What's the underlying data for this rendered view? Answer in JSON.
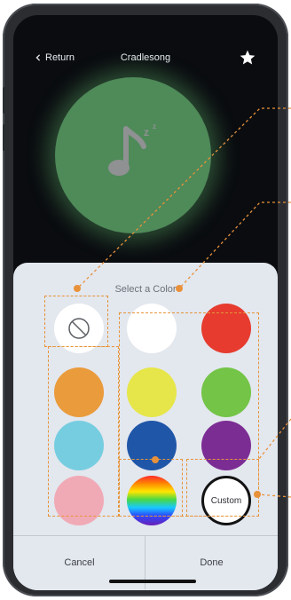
{
  "nav": {
    "return_label": "Return",
    "title": "Cradlesong"
  },
  "sheet": {
    "title": "Select a Color",
    "custom_label": "Custom"
  },
  "footer": {
    "cancel_label": "Cancel",
    "done_label": "Done"
  },
  "colors": {
    "background": "#0a0c10",
    "glow": "#4f8a59",
    "sheet": "#e3e7ee",
    "annotation": "#e8913a",
    "swatches": {
      "white": "#ffffff",
      "red": "#e63b2e",
      "orange": "#ea9b3c",
      "yellow": "#e6e64a",
      "green": "#73c447",
      "cyan": "#76cde0",
      "blue": "#1f56a8",
      "purple": "#7c2d94",
      "pink": "#f0aab6"
    }
  },
  "icons": [
    "chevron-left-icon",
    "star-icon",
    "music-note-sleep-icon",
    "no-color-icon"
  ]
}
